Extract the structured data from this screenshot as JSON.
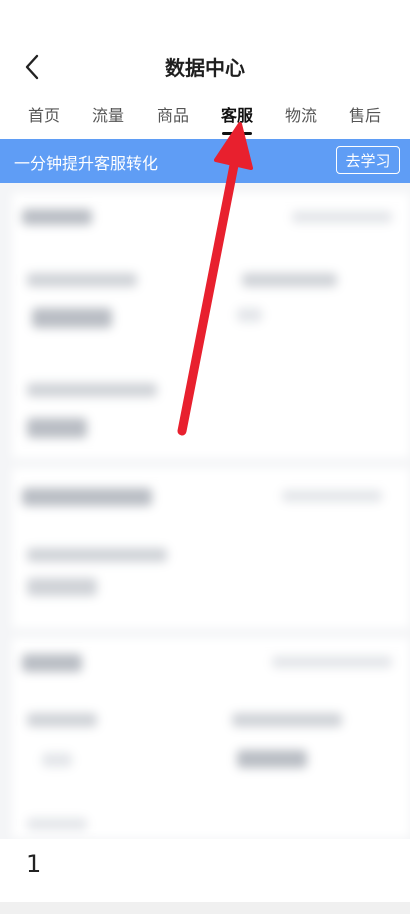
{
  "header": {
    "title": "数据中心"
  },
  "tabs": [
    {
      "label": "首页"
    },
    {
      "label": "流量"
    },
    {
      "label": "商品"
    },
    {
      "label": "客服"
    },
    {
      "label": "物流"
    },
    {
      "label": "售后"
    }
  ],
  "active_tab": "客服",
  "banner": {
    "text": "一分钟提升客服转化",
    "button_label": "去学习"
  },
  "footer": {
    "page_number": "1"
  },
  "colors": {
    "banner_bg": "#5f9df5",
    "arrow": "#e8202e"
  }
}
